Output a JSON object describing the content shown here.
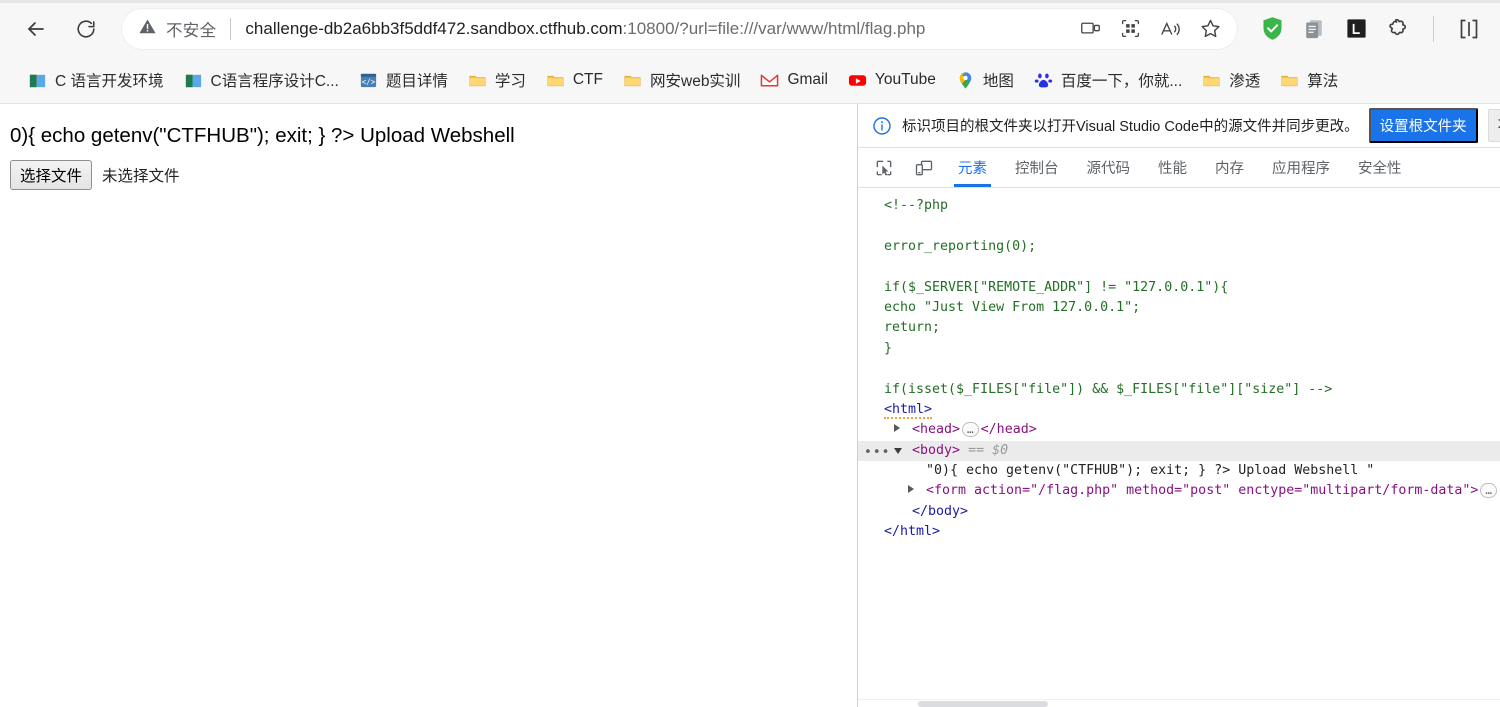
{
  "browser": {
    "nav": {
      "back_icon": "back-arrow-icon",
      "reload_icon": "reload-icon"
    },
    "omnibox": {
      "security_icon": "warning-triangle-icon",
      "security_label": "不安全",
      "url_host": "challenge-db2a6bb3f5ddf472.sandbox.ctfhub.com",
      "url_rest": ":10800/?url=file:///var/www/html/flag.php",
      "full_url": "challenge-db2a6bb3f5ddf472.sandbox.ctfhub.com:10800/?url=file:///var/www/html/flag.php",
      "icons": [
        "split-screen-icon",
        "qr-code-icon",
        "read-aloud-icon",
        "favorite-star-icon"
      ]
    },
    "extensions": [
      {
        "name": "adblock-shield-icon",
        "color": "#3ab549"
      },
      {
        "name": "clipboard-copy-icon",
        "color": "#9aa0a6"
      },
      {
        "name": "lastpass-icon",
        "color": "#1f1f1f"
      },
      {
        "name": "puzzle-extension-icon",
        "color": "#3c4043"
      },
      {
        "name": "browser-essentials-icon",
        "color": "#3c4043"
      }
    ],
    "bookmarks": [
      {
        "label": "C 语言开发环境",
        "icon": "book-icon"
      },
      {
        "label": "C语言程序设计C...",
        "icon": "book-icon"
      },
      {
        "label": "题目详情",
        "icon": "code-page-icon"
      },
      {
        "label": "学习",
        "icon": "folder-icon"
      },
      {
        "label": "CTF",
        "icon": "folder-icon"
      },
      {
        "label": "网安web实训",
        "icon": "folder-icon"
      },
      {
        "label": "Gmail",
        "icon": "gmail-icon"
      },
      {
        "label": "YouTube",
        "icon": "youtube-icon"
      },
      {
        "label": "地图",
        "icon": "map-pin-icon"
      },
      {
        "label": "百度一下，你就...",
        "icon": "baidu-icon"
      },
      {
        "label": "渗透",
        "icon": "folder-icon"
      },
      {
        "label": "算法",
        "icon": "folder-icon"
      }
    ]
  },
  "page": {
    "heading_text": "0){ echo getenv(\"CTFHUB\"); exit; } ?> Upload Webshell",
    "choose_file_button": "选择文件",
    "no_file_label": "未选择文件"
  },
  "devtools": {
    "notice": {
      "icon": "info-circle-icon",
      "text": "标识项目的根文件夹以打开Visual Studio Code中的源文件并同步更改。",
      "primary_button": "设置根文件夹",
      "secondary_button": "不"
    },
    "toolbar_icons": [
      "inspect-element-icon",
      "device-toolbar-icon"
    ],
    "tabs": [
      {
        "label": "元素",
        "active": true
      },
      {
        "label": "控制台",
        "active": false
      },
      {
        "label": "源代码",
        "active": false
      },
      {
        "label": "性能",
        "active": false
      },
      {
        "label": "内存",
        "active": false
      },
      {
        "label": "应用程序",
        "active": false
      },
      {
        "label": "安全性",
        "active": false
      }
    ],
    "dom": {
      "comment_lines": [
        "<!--?php",
        "error_reporting(0);",
        "if($_SERVER[\"REMOTE_ADDR\"] != \"127.0.0.1\"){",
        "    echo \"Just View From 127.0.0.1\";",
        "    return;",
        "}",
        "if(isset($_FILES[\"file\"]) && $_FILES[\"file\"][\"size\"] -->"
      ],
      "html_open": "<html>",
      "head_open": "<head>",
      "head_close": "</head>",
      "head_ellipsis": "…",
      "body_open": "<body>",
      "body_selected_marker": "== $0",
      "body_text_node": "\"0){ echo getenv(\"CTFHUB\"); exit; } ?> Upload Webshell \"",
      "form_line": "<form action=\"/flag.php\" method=\"post\" enctype=\"multipart/form-data\">",
      "form_ellipsis": "…",
      "body_close": "</body>",
      "html_close": "</html>",
      "row_menu_dots": "•••"
    }
  }
}
